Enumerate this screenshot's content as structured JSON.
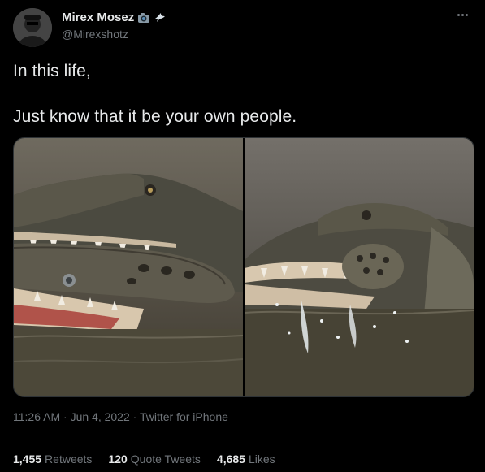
{
  "author": {
    "display_name": "Mirex Mosez",
    "handle": "@Mirexshotz",
    "badges": [
      "camera-emoji",
      "dove-emoji"
    ]
  },
  "tweet": {
    "line1": "In this life,",
    "line2": "Just know that it be your own people."
  },
  "meta": {
    "time": "11:26 AM",
    "sep1": "·",
    "date": "Jun 4, 2022",
    "sep2": "·",
    "source": "Twitter for iPhone"
  },
  "stats": [
    {
      "count": "1,455",
      "label": "Retweets"
    },
    {
      "count": "120",
      "label": "Quote Tweets"
    },
    {
      "count": "4,685",
      "label": "Likes"
    }
  ],
  "colors": {
    "background": "#000000",
    "text_primary": "#e7e9ea",
    "text_secondary": "#71767b",
    "divider": "#2f3336"
  }
}
